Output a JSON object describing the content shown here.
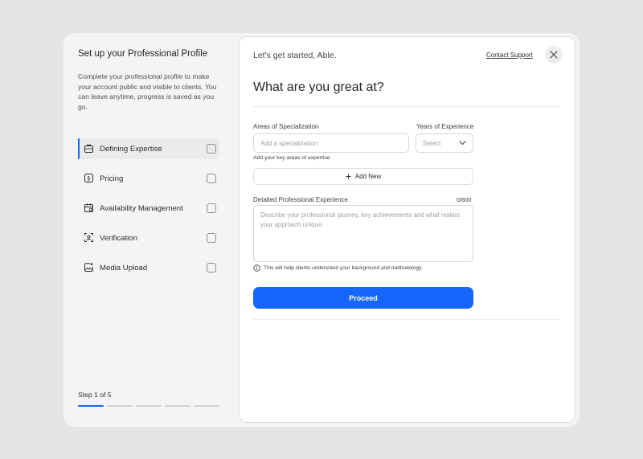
{
  "sidebar": {
    "title": "Set up your Professional Profile",
    "description": "Complete your professional profile to make your account public and visible to clients. You can leave anytime, progress is saved as you go.",
    "steps": [
      {
        "label": "Defining Expertise",
        "icon": "briefcase-icon"
      },
      {
        "label": "Pricing",
        "icon": "price-tag-icon"
      },
      {
        "label": "Availability Management",
        "icon": "calendar-icon"
      },
      {
        "label": "Verification",
        "icon": "face-scan-icon"
      },
      {
        "label": "Media Upload",
        "icon": "image-upload-icon"
      }
    ],
    "step_text": "Step 1 of 5",
    "progress": {
      "current": 1,
      "total": 5
    }
  },
  "header": {
    "greeting": "Let's get started, Able.",
    "contact_label": "Contact Support",
    "close_icon": "close-icon"
  },
  "form": {
    "heading": "What are you great at?",
    "specialization_label": "Areas of Specialization",
    "specialization_placeholder": "Add a specialization",
    "specialization_hint": "Add your key areas of expertise",
    "experience_label": "Years of Experience",
    "experience_value": "Select",
    "add_new_label": "Add New",
    "details_label": "Detailed Professional Experience",
    "details_counter": "0/600",
    "details_placeholder": "Describe your professional journey, key achievements and what makes your approach unique.",
    "details_info": "This will help clients understand your background and methodology.",
    "proceed_label": "Proceed"
  },
  "colors": {
    "accent": "#1466ff",
    "background": "#e4e4e4",
    "panel": "#f4f4f4",
    "card": "#ffffff"
  }
}
